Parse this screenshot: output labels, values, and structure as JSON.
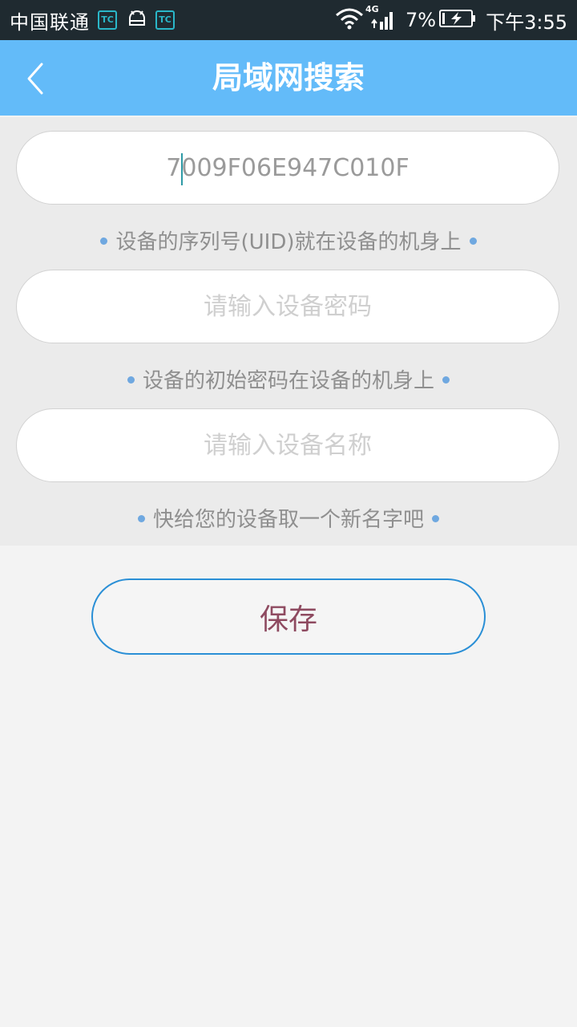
{
  "status_bar": {
    "carrier": "中国联通",
    "badge_text": "TC",
    "network_type": "4G",
    "battery_percent": "7%",
    "time": "下午3:55",
    "icons": [
      "tc-app-icon",
      "android-icon",
      "tc-app-icon",
      "wifi-icon",
      "signal-icon",
      "battery-charging-icon"
    ]
  },
  "app_bar": {
    "title": "局域网搜索",
    "back_icon": "chevron-left-icon",
    "color": "#63bbf9"
  },
  "form": {
    "uid": {
      "value": "7009F06E947C010F",
      "hint": "设备的序列号(UID)就在设备的机身上"
    },
    "password": {
      "value": "",
      "placeholder": "请输入设备密码",
      "hint": "设备的初始密码在设备的机身上"
    },
    "name": {
      "value": "",
      "placeholder": "请输入设备名称",
      "hint": "快给您的设备取一个新名字吧"
    }
  },
  "actions": {
    "save_label": "保存",
    "accent": "#2a8fd6",
    "label_color": "#8e4a60"
  }
}
